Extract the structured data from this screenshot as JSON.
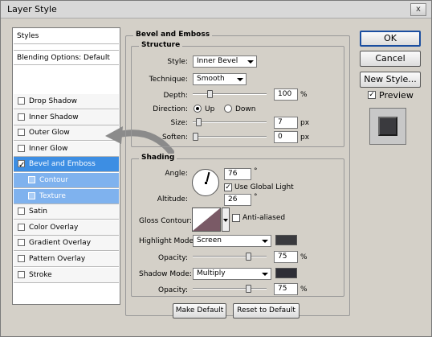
{
  "window": {
    "title": "Layer Style",
    "close_glyph": "x"
  },
  "styles_panel": {
    "header": "Styles",
    "blending": "Blending Options: Default",
    "items": [
      {
        "label": "Drop Shadow",
        "checked": false
      },
      {
        "label": "Inner Shadow",
        "checked": false
      },
      {
        "label": "Outer Glow",
        "checked": false
      },
      {
        "label": "Inner Glow",
        "checked": false
      },
      {
        "label": "Bevel and Emboss",
        "checked": true,
        "selected": true
      },
      {
        "label": "Contour",
        "checked": false,
        "sub": true
      },
      {
        "label": "Texture",
        "checked": false,
        "sub": true
      },
      {
        "label": "Satin",
        "checked": false
      },
      {
        "label": "Color Overlay",
        "checked": false
      },
      {
        "label": "Gradient Overlay",
        "checked": false
      },
      {
        "label": "Pattern Overlay",
        "checked": false
      },
      {
        "label": "Stroke",
        "checked": false
      }
    ]
  },
  "bevel": {
    "title": "Bevel and Emboss",
    "structure_title": "Structure",
    "style_label": "Style:",
    "style_value": "Inner Bevel",
    "technique_label": "Technique:",
    "technique_value": "Smooth",
    "depth_label": "Depth:",
    "depth_value": "100",
    "depth_unit": "%",
    "direction_label": "Direction:",
    "dir_up": "Up",
    "dir_down": "Down",
    "size_label": "Size:",
    "size_value": "7",
    "size_unit": "px",
    "soften_label": "Soften:",
    "soften_value": "0",
    "soften_unit": "px",
    "shading_title": "Shading",
    "angle_label": "Angle:",
    "angle_value": "76",
    "angle_unit": "°",
    "global_light": "Use Global Light",
    "altitude_label": "Altitude:",
    "altitude_value": "26",
    "altitude_unit": "°",
    "gloss_label": "Gloss Contour:",
    "anti_aliased": "Anti-aliased",
    "highlight_label": "Highlight Mode:",
    "highlight_value": "Screen",
    "hl_opacity_label": "Opacity:",
    "hl_opacity_value": "75",
    "hl_opacity_unit": "%",
    "shadow_label": "Shadow Mode:",
    "shadow_value": "Multiply",
    "sh_opacity_label": "Opacity:",
    "sh_opacity_value": "75",
    "sh_opacity_unit": "%",
    "make_default": "Make Default",
    "reset_default": "Reset to Default"
  },
  "buttons": {
    "ok": "OK",
    "cancel": "Cancel",
    "new_style": "New Style...",
    "preview": "Preview"
  },
  "colors": {
    "selected": "#3d8ee3",
    "sub_selected": "#7fb2ee",
    "highlight_swatch": "#3a3a3e",
    "shadow_swatch": "#2e2e36",
    "arrow": "#8b8b8b"
  }
}
